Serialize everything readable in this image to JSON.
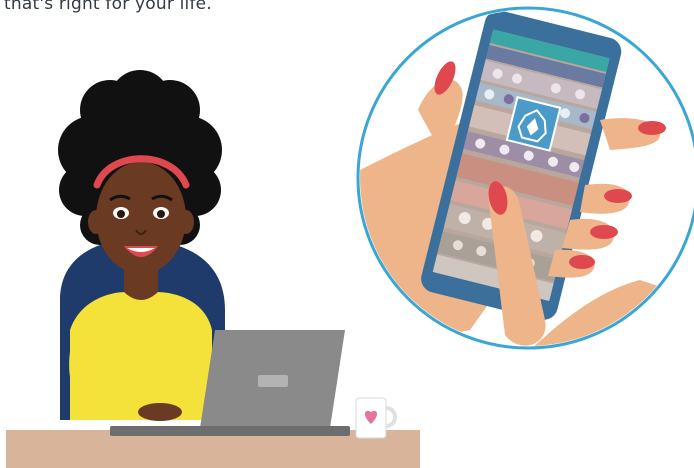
{
  "caption": "that's right for your life.",
  "icons": {
    "woman": "woman-illustration",
    "laptop": "laptop-icon",
    "mug": "heart-mug-icon",
    "phone": "smartphone-icon",
    "logo": "brand-logo-icon"
  },
  "colors": {
    "circle_border": "#3aa6d6",
    "skin": "#efb58a",
    "nails": "#e0484f",
    "phone_body": "#3b6f9c",
    "sweater": "#f4e23a",
    "chair": "#1f3b6b",
    "desk": "#d8b59a",
    "laptop": "#8a8a8a",
    "logo_bg": "#4a9bc9"
  }
}
